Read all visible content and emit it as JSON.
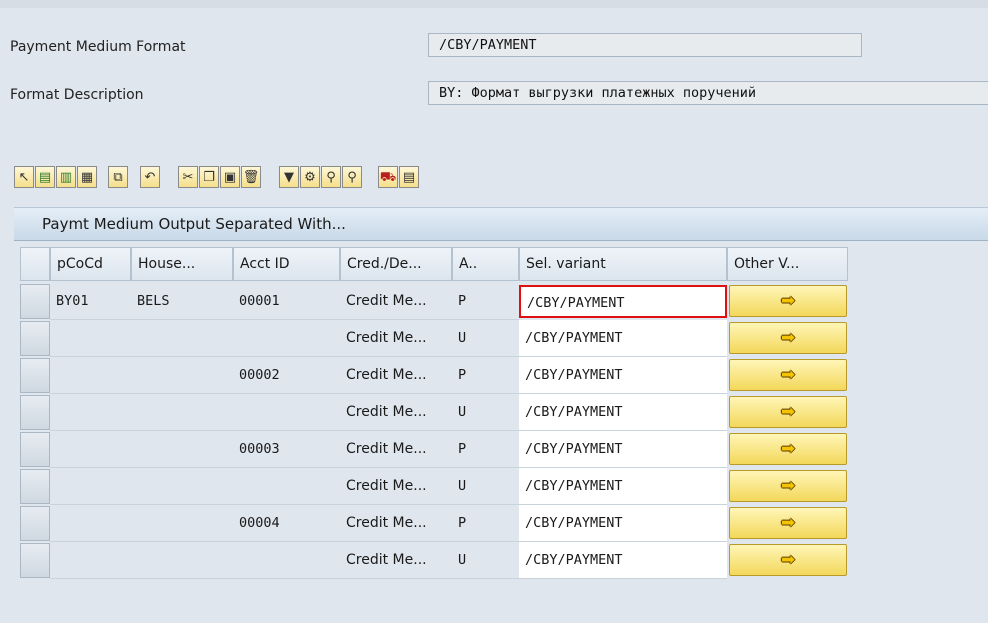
{
  "header": {
    "format_label": "Payment Medium Format",
    "format_value": "/CBY/PAYMENT",
    "description_label": "Format Description",
    "description_value": "BY: Формат выгрузки платежных поручений"
  },
  "toolbar": {
    "buttons": [
      "select-icon",
      "select-all-icon",
      "deselect-icon",
      "select-block-icon",
      "copy-row-icon",
      "undo-icon",
      "cut-icon",
      "copy-icon",
      "paste-icon",
      "delete-icon",
      "filter-icon",
      "filter-settings-icon",
      "find-icon",
      "find-next-icon",
      "export-icon",
      "details-icon"
    ]
  },
  "panel": {
    "title": "Paymt Medium Output Separated With..."
  },
  "table": {
    "columns": [
      "pCoCd",
      "House...",
      "Acct ID",
      "Cred./De...",
      "A..",
      "Sel. variant",
      "Other V..."
    ],
    "rows": [
      {
        "cocd": "BY01",
        "house": "BELS",
        "acct": "00001",
        "cred": "Credit Me...",
        "a": "P",
        "sel": "/CBY/PAYMENT"
      },
      {
        "cocd": "",
        "house": "",
        "acct": "",
        "cred": "Credit Me...",
        "a": "U",
        "sel": "/CBY/PAYMENT"
      },
      {
        "cocd": "",
        "house": "",
        "acct": "00002",
        "cred": "Credit Me...",
        "a": "P",
        "sel": "/CBY/PAYMENT"
      },
      {
        "cocd": "",
        "house": "",
        "acct": "",
        "cred": "Credit Me...",
        "a": "U",
        "sel": "/CBY/PAYMENT"
      },
      {
        "cocd": "",
        "house": "",
        "acct": "00003",
        "cred": "Credit Me...",
        "a": "P",
        "sel": "/CBY/PAYMENT"
      },
      {
        "cocd": "",
        "house": "",
        "acct": "",
        "cred": "Credit Me...",
        "a": "U",
        "sel": "/CBY/PAYMENT"
      },
      {
        "cocd": "",
        "house": "",
        "acct": "00004",
        "cred": "Credit Me...",
        "a": "P",
        "sel": "/CBY/PAYMENT"
      },
      {
        "cocd": "",
        "house": "",
        "acct": "",
        "cred": "Credit Me...",
        "a": "U",
        "sel": "/CBY/PAYMENT"
      }
    ],
    "other_button_icon": "arrow-right-icon",
    "active_cell": "selection variant in first row"
  },
  "colors": {
    "accent_border": "#e01010",
    "button_yellow": "#f3d85a"
  }
}
